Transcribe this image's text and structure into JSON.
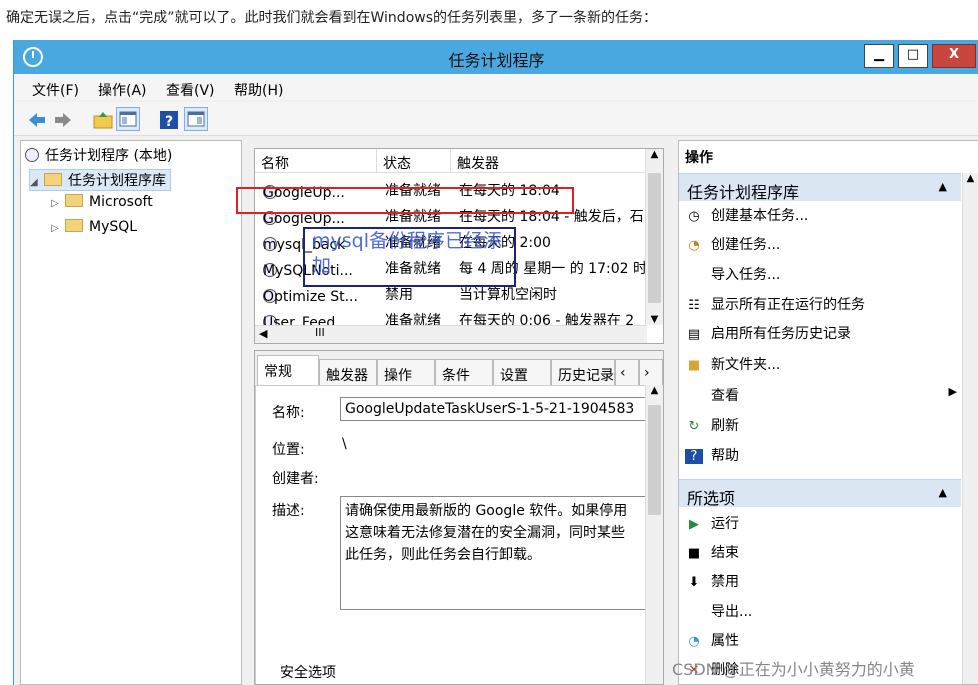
{
  "caption": "确定无误之后，点击“完成”就可以了。此时我们就会看到在Windows的任务列表里，多了一条新的任务：",
  "window": {
    "title": "任务计划程序",
    "controls": {
      "minimize": "▁",
      "maximize": "□",
      "close": "X"
    }
  },
  "menu": [
    "文件(F)",
    "操作(A)",
    "查看(V)",
    "帮助(H)"
  ],
  "tree": {
    "root": "任务计划程序 (本地)",
    "library": "任务计划程序库",
    "children": [
      "Microsoft",
      "MySQL"
    ]
  },
  "tasklist": {
    "headers": [
      "名称",
      "状态",
      "触发器"
    ],
    "rows": [
      {
        "name": "GoogleUp...",
        "status": "准备就绪",
        "trigger": "在每天的 18:04"
      },
      {
        "name": "GoogleUp...",
        "status": "准备就绪",
        "trigger": "在每天的 18:04 - 触发后，石"
      },
      {
        "name": "mysql_back",
        "status": "准备就绪",
        "trigger": "在每天的 2:00"
      },
      {
        "name": "MySQLNoti...",
        "status": "准备就绪",
        "trigger": "每 4 周的 星期一 的 17:02 时"
      },
      {
        "name": "Optimize St...",
        "status": "禁用",
        "trigger": "当计算机空闲时"
      },
      {
        "name": "User_Feed...",
        "status": "准备就绪",
        "trigger": "在每天的 0:06 - 触发器在 2"
      }
    ],
    "hscroll_label": "III"
  },
  "annotation": "mysql备份程序已经添加",
  "detail": {
    "tabs": [
      "常规",
      "触发器",
      "操作",
      "条件",
      "设置",
      "历史记录"
    ],
    "name_label": "名称:",
    "name_value": "GoogleUpdateTaskUserS-1-5-21-1904583",
    "location_label": "位置:",
    "location_value": "\\",
    "author_label": "创建者:",
    "desc_label": "描述:",
    "desc_value": "请确保使用最新版的 Google 软件。如果停用 这意味着无法修复潜在的安全漏洞，同时某些 此任务，则此任务会自行卸载。",
    "security_label": "安全选项"
  },
  "actions": {
    "title": "操作",
    "section1": "任务计划程序库",
    "items1": [
      {
        "label": "创建基本任务...",
        "icon": "clock-icon"
      },
      {
        "label": "创建任务...",
        "icon": "clock-small-icon"
      },
      {
        "label": "导入任务...",
        "icon": ""
      },
      {
        "label": "显示所有正在运行的任务",
        "icon": "list-icon"
      },
      {
        "label": "启用所有任务历史记录",
        "icon": "history-icon"
      },
      {
        "label": "新文件夹...",
        "icon": "folder-icon"
      },
      {
        "label": "查看",
        "icon": ""
      },
      {
        "label": "刷新",
        "icon": "refresh-icon"
      },
      {
        "label": "帮助",
        "icon": "help-icon"
      }
    ],
    "section2": "所选项",
    "items2": [
      {
        "label": "运行",
        "icon": "play-icon"
      },
      {
        "label": "结束",
        "icon": "stop-icon"
      },
      {
        "label": "禁用",
        "icon": "disable-icon"
      },
      {
        "label": "导出...",
        "icon": ""
      },
      {
        "label": "属性",
        "icon": "properties-icon"
      },
      {
        "label": "删除",
        "icon": "delete-icon"
      }
    ]
  },
  "watermark": "CSDN @正在为小小黄努力的小黄",
  "colors": {
    "titlebar": "#4aa8e0",
    "close": "#c7463e",
    "red_box": "#e02020",
    "blue_box": "#1a237e"
  }
}
